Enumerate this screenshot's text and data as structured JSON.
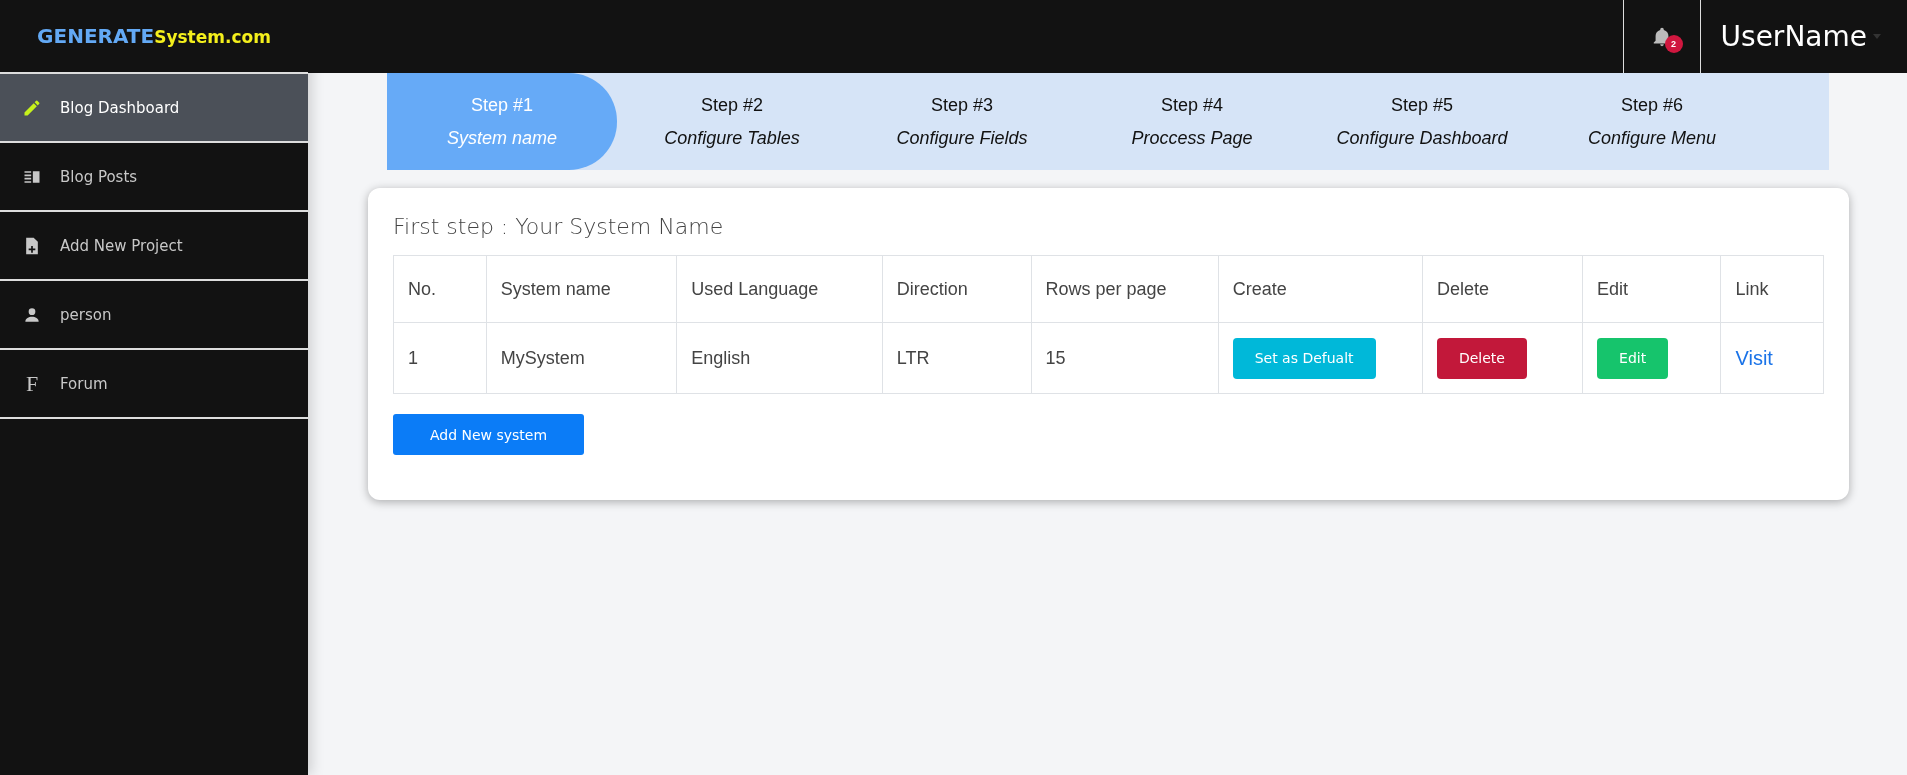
{
  "logo": {
    "part1": "GENERATE",
    "part2": "System.com"
  },
  "sidebar": {
    "items": [
      {
        "label": "Blog Dashboard",
        "selected": true
      },
      {
        "label": "Blog Posts",
        "selected": false
      },
      {
        "label": "Add New Project",
        "selected": false
      },
      {
        "label": "person",
        "selected": false
      },
      {
        "label": "Forum",
        "selected": false,
        "icon_text": "F"
      }
    ]
  },
  "topbar": {
    "notification_count": "2",
    "user": "UserName"
  },
  "steps": [
    {
      "step": "Step #1",
      "label": "System name",
      "selected": true
    },
    {
      "step": "Step #2",
      "label": "Configure Tables",
      "selected": false
    },
    {
      "step": "Step #3",
      "label": "Configure Fields",
      "selected": false
    },
    {
      "step": "Step #4",
      "label": "Proccess Page",
      "selected": false
    },
    {
      "step": "Step #5",
      "label": "Configure Dashboard",
      "selected": false
    },
    {
      "step": "Step #6",
      "label": "Configure Menu",
      "selected": false
    }
  ],
  "card": {
    "title": "First step : Your System Name",
    "table": {
      "columns": [
        "No.",
        "System name",
        "Used Language",
        "Direction",
        "Rows per page",
        "Create",
        "Delete",
        "Edit",
        "Link"
      ],
      "rows": [
        [
          {
            "kind": "text",
            "text": "1"
          },
          {
            "kind": "text",
            "text": "MySystem"
          },
          {
            "kind": "text",
            "text": "English"
          },
          {
            "kind": "text",
            "text": "LTR"
          },
          {
            "kind": "text",
            "text": "15"
          },
          {
            "kind": "button",
            "text": "Set as Defualt",
            "color": "#00b8d9"
          },
          {
            "kind": "button",
            "text": "Delete",
            "color": "#c2183a"
          },
          {
            "kind": "button",
            "text": "Edit",
            "color": "#16c46c"
          },
          {
            "kind": "link",
            "text": "Visit"
          }
        ]
      ]
    },
    "add_button": "Add New system"
  }
}
